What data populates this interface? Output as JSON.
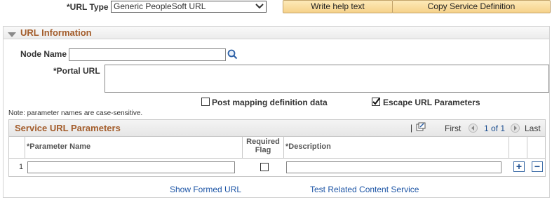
{
  "top": {
    "url_type_label": "*URL Type",
    "url_type_value": "Generic PeopleSoft URL",
    "write_help_label": "Write help text",
    "copy_service_label": "Copy Service Definition"
  },
  "section": {
    "title": "URL Information",
    "node_name_label": "Node Name",
    "node_name_value": "",
    "portal_url_label": "*Portal URL",
    "portal_url_value": "",
    "post_mapping_label": "Post mapping definition data",
    "post_mapping_checked": false,
    "escape_url_label": "Escape URL Parameters",
    "escape_url_checked": true,
    "note": "Note: parameter names are case-sensitive."
  },
  "grid": {
    "title": "Service URL Parameters",
    "nav_first": "First",
    "nav_range": "1 of 1",
    "nav_last": "Last",
    "columns": {
      "param_name": "*Parameter Name",
      "required_flag_line1": "Required",
      "required_flag_line2": "Flag",
      "description": "*Description"
    },
    "rows": [
      {
        "num": "1",
        "param_name": "",
        "required": false,
        "description": ""
      }
    ]
  },
  "footer": {
    "show_formed_url": "Show Formed URL",
    "test_related": "Test Related Content Service"
  }
}
